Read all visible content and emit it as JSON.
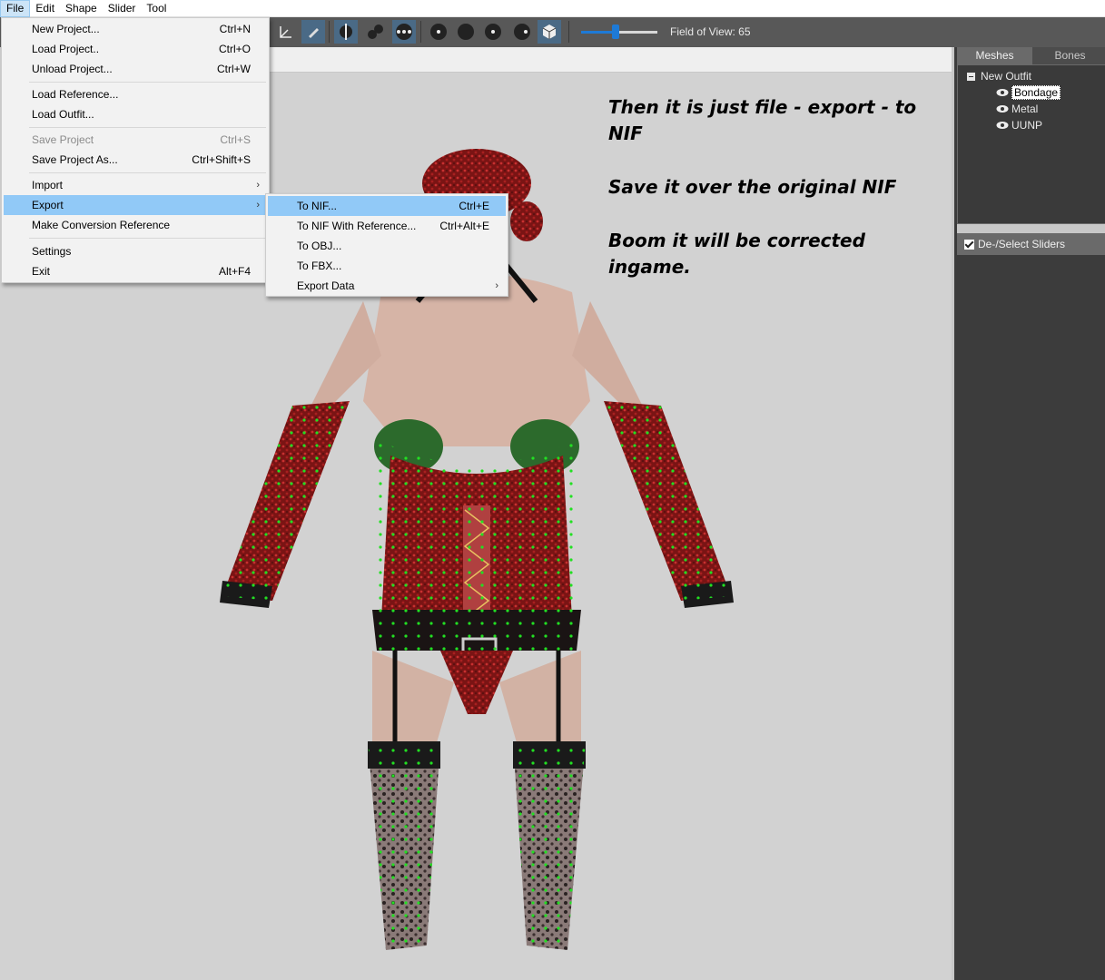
{
  "menubar": {
    "items": [
      "File",
      "Edit",
      "Shape",
      "Slider",
      "Tool"
    ]
  },
  "toolbar": {
    "fov_label": "Field of View: 65",
    "fov_slider_fraction": 0.45
  },
  "file_menu": {
    "items": [
      {
        "label": "New Project...",
        "shortcut": "Ctrl+N"
      },
      {
        "label": "Load Project..",
        "shortcut": "Ctrl+O"
      },
      {
        "label": "Unload Project...",
        "shortcut": "Ctrl+W"
      },
      {
        "label": "Load Reference...",
        "shortcut": ""
      },
      {
        "label": "Load Outfit...",
        "shortcut": ""
      },
      {
        "label": "Save Project",
        "shortcut": "Ctrl+S"
      },
      {
        "label": "Save Project As...",
        "shortcut": "Ctrl+Shift+S"
      },
      {
        "label": "Import",
        "shortcut": ""
      },
      {
        "label": "Export",
        "shortcut": ""
      },
      {
        "label": "Make Conversion Reference",
        "shortcut": ""
      },
      {
        "label": "Settings",
        "shortcut": ""
      },
      {
        "label": "Exit",
        "shortcut": "Alt+F4"
      }
    ]
  },
  "export_menu": {
    "items": [
      {
        "label": "To NIF...",
        "shortcut": "Ctrl+E"
      },
      {
        "label": "To NIF With Reference...",
        "shortcut": "Ctrl+Alt+E"
      },
      {
        "label": "To OBJ...",
        "shortcut": ""
      },
      {
        "label": "To FBX...",
        "shortcut": ""
      },
      {
        "label": "Export Data",
        "shortcut": ""
      }
    ]
  },
  "viewport": {
    "instructions": [
      "Then it is just file - export - to NIF",
      "Save it over the original NIF",
      "Boom it will be corrected ingame."
    ]
  },
  "right_panel": {
    "tabs": [
      "Meshes",
      "Bones"
    ],
    "tree": {
      "root": "New Outfit",
      "meshes": [
        "Bondage",
        "Metal",
        "UUNP"
      ]
    },
    "sliders_header": "De-/Select Sliders"
  },
  "colors": {
    "menu_highlight": "#91c9f7",
    "toolbar_bg": "#585858",
    "viewport_bg": "#d2d2d2",
    "panel_bg": "#3c3c3c",
    "accent_blue": "#1e7ad6"
  }
}
